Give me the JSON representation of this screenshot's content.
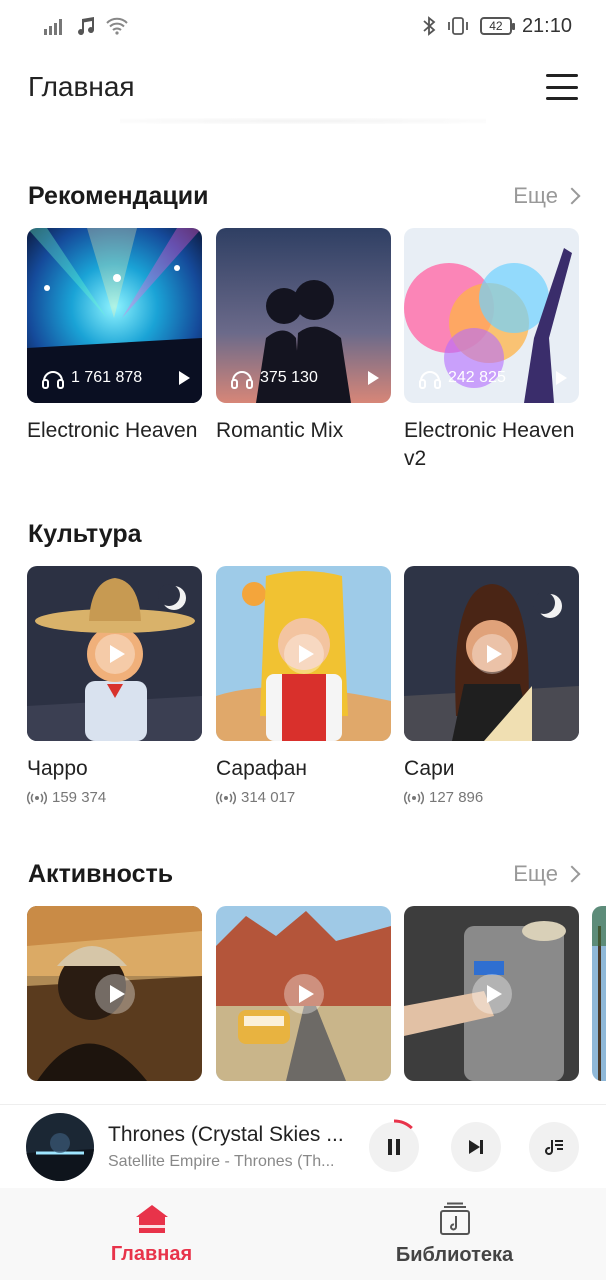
{
  "status": {
    "time": "21:10",
    "battery": "42"
  },
  "header": {
    "title": "Главная"
  },
  "recommendations": {
    "title": "Рекомендации",
    "more": "Еще",
    "items": [
      {
        "title": "Electronic Heaven",
        "listens": "1 761 878"
      },
      {
        "title": "Romantic Mix",
        "listens": "375 130"
      },
      {
        "title": "Electronic Heaven v2",
        "listens": "242 825"
      }
    ]
  },
  "culture": {
    "title": "Культура",
    "items": [
      {
        "title": "Чарро",
        "count": "159 374"
      },
      {
        "title": "Сарафан",
        "count": "314 017"
      },
      {
        "title": "Сари",
        "count": "127 896"
      }
    ]
  },
  "activity": {
    "title": "Активность",
    "more": "Еще"
  },
  "player": {
    "title": "Thrones (Crystal Skies ...",
    "artist": "Satellite Empire - Thrones (Th...",
    "progress": 0.12
  },
  "nav": {
    "home": "Главная",
    "library": "Библиотека",
    "active_color": "#e8334a"
  }
}
